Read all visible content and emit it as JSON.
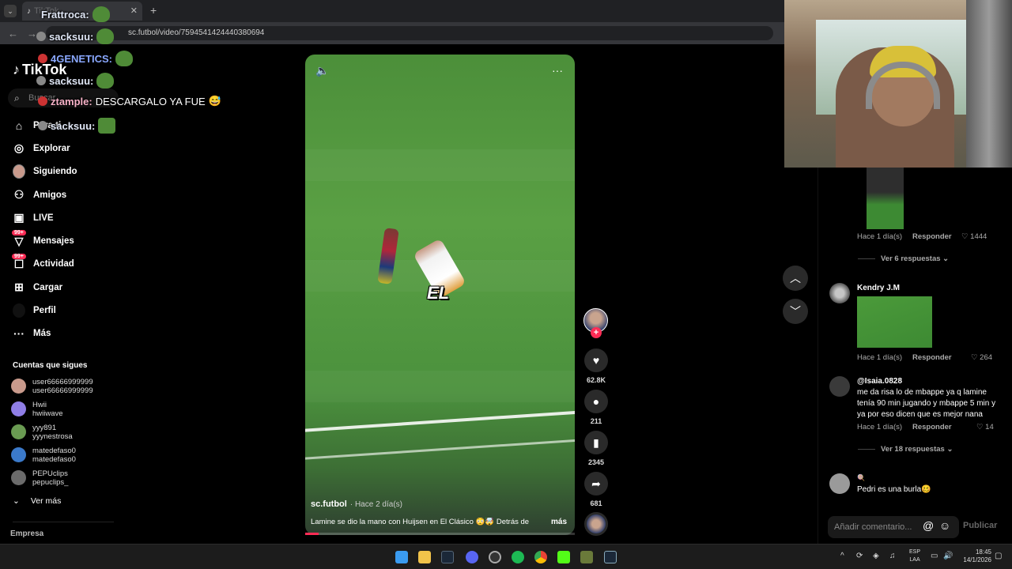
{
  "browser": {
    "tab_title": "TikTok",
    "url": "sc.futbol/video/7594541424440380694"
  },
  "chat": [
    {
      "user": "Frattroca:",
      "message": ""
    },
    {
      "user": "sacksuu:",
      "message": ""
    },
    {
      "user": "4GENETICS:",
      "message": ""
    },
    {
      "user": "sacksuu:",
      "message": ""
    },
    {
      "user": "ztample:",
      "message": "DESCARGALO YA FUE"
    },
    {
      "user": "sacksuu:",
      "message": ""
    }
  ],
  "sidebar": {
    "logo_text": "TikTok",
    "search_placeholder": "Buscar",
    "items": [
      {
        "label": "Para ti",
        "icon": "home-icon"
      },
      {
        "label": "Explorar",
        "icon": "compass-icon"
      },
      {
        "label": "Siguiendo",
        "icon": "following-avatar-icon"
      },
      {
        "label": "Amigos",
        "icon": "friends-icon"
      },
      {
        "label": "LIVE",
        "icon": "live-icon"
      },
      {
        "label": "Mensajes",
        "icon": "messages-icon",
        "badge": "99+"
      },
      {
        "label": "Actividad",
        "icon": "activity-icon",
        "badge": "99+"
      },
      {
        "label": "Cargar",
        "icon": "upload-icon"
      },
      {
        "label": "Perfil",
        "icon": "profile-icon"
      },
      {
        "label": "Más",
        "icon": "more-icon"
      }
    ],
    "following_title": "Cuentas que sigues",
    "following": [
      {
        "name": "user66666999999",
        "handle": "user66666999999",
        "color": "#c99a8c"
      },
      {
        "name": "Hwii",
        "handle": "hwiiwave",
        "color": "#8f7ee6"
      },
      {
        "name": "yyy891",
        "handle": "yyynestrosa",
        "color": "#6a9b52"
      },
      {
        "name": "matedefaso0",
        "handle": "matedefaso0",
        "color": "#3b7acb"
      },
      {
        "name": "PEPUclips",
        "handle": "pepuclips_",
        "color": "#6b6b6b"
      }
    ],
    "see_more": "Ver más",
    "company": "Empresa"
  },
  "video": {
    "caption_overlay": "EL",
    "author": "sc.futbol",
    "posted": "· Hace 2 día(s)",
    "description": "Lamine se dio la mano con Huijsen en El Clásico 😳🤯 Detrás de",
    "more": "más",
    "progress": 0.05
  },
  "actions": {
    "likes": "62.8K",
    "comments": "211",
    "saves": "2345",
    "shares": "681"
  },
  "comments": {
    "items": [
      {
        "time": "Hace 1 día(s)",
        "reply": "Responder",
        "likes": "1444",
        "thread": "Ver 6 respuestas"
      },
      {
        "name": "Kendry J.M",
        "time": "Hace 1 día(s)",
        "reply": "Responder",
        "likes": "264"
      },
      {
        "name": "@Isaia.0828",
        "text": "me da risa lo de mbappe ya q lamine tenía 90 min jugando y mbappe 5 min y ya por eso dicen que es mejor nana",
        "time": "Hace 1 día(s)",
        "reply": "Responder",
        "likes": "14",
        "thread": "Ver 18 respuestas"
      },
      {
        "name": "🍭",
        "text": "Pedri es una burla🥴"
      }
    ],
    "input_placeholder": "Añadir comentario...",
    "publish": "Publicar"
  },
  "taskbar": {
    "lang_line1": "ESP",
    "lang_line2": "LAA",
    "time": "18:45",
    "date": "14/1/2026"
  }
}
